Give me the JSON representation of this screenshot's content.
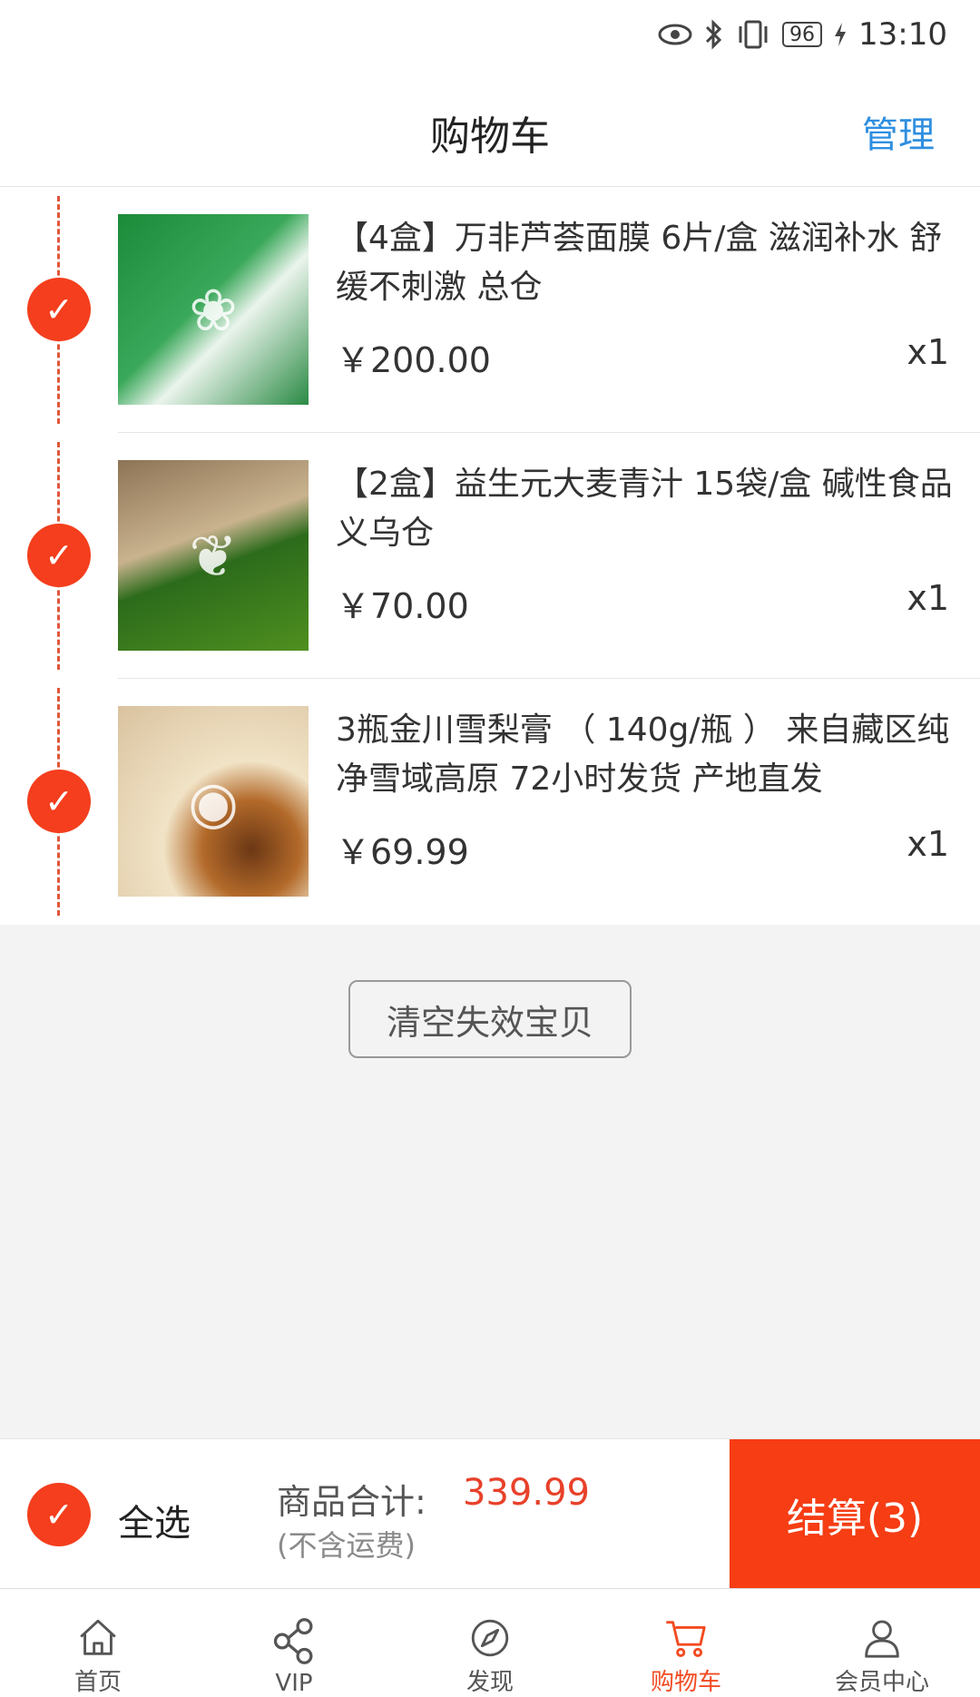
{
  "status_bar": {
    "battery": "96",
    "time": "13:10",
    "icons": [
      "eye-icon",
      "bluetooth-icon",
      "vibrate-icon",
      "battery-icon",
      "charging-icon"
    ]
  },
  "header": {
    "title": "购物车",
    "manage_label": "管理"
  },
  "cart_items": [
    {
      "name": "【4盒】万非芦荟面膜 6片/盒 滋润补水 舒缓不刺激 总仓",
      "price": "￥200.00",
      "quantity": "x1",
      "selected": true
    },
    {
      "name": "【2盒】益生元大麦青汁  15袋/盒 碱性食品  义乌仓",
      "price": "￥70.00",
      "quantity": "x1",
      "selected": true
    },
    {
      "name": "3瓶金川雪梨膏 （ 140g/瓶 ） 来自藏区纯净雪域高原  72小时发货 产地直发",
      "price": "￥69.99",
      "quantity": "x1",
      "selected": true
    }
  ],
  "clear_invalid_label": "清空失效宝贝",
  "checkout": {
    "select_all_label": "全选",
    "total_label": "商品合计:",
    "total_value": "339.99",
    "shipping_note": "(不含运费)",
    "checkout_label": "结算(3)"
  },
  "tabs": [
    {
      "label": "首页",
      "icon": "home-icon",
      "active": false
    },
    {
      "label": "VIP",
      "icon": "share-icon",
      "active": false
    },
    {
      "label": "发现",
      "icon": "compass-icon",
      "active": false
    },
    {
      "label": "购物车",
      "icon": "cart-icon",
      "active": true
    },
    {
      "label": "会员中心",
      "icon": "user-icon",
      "active": false
    }
  ],
  "colors": {
    "accent": "#f63d14",
    "manage_link": "#2f8fe0",
    "total_value": "#e8412a"
  }
}
